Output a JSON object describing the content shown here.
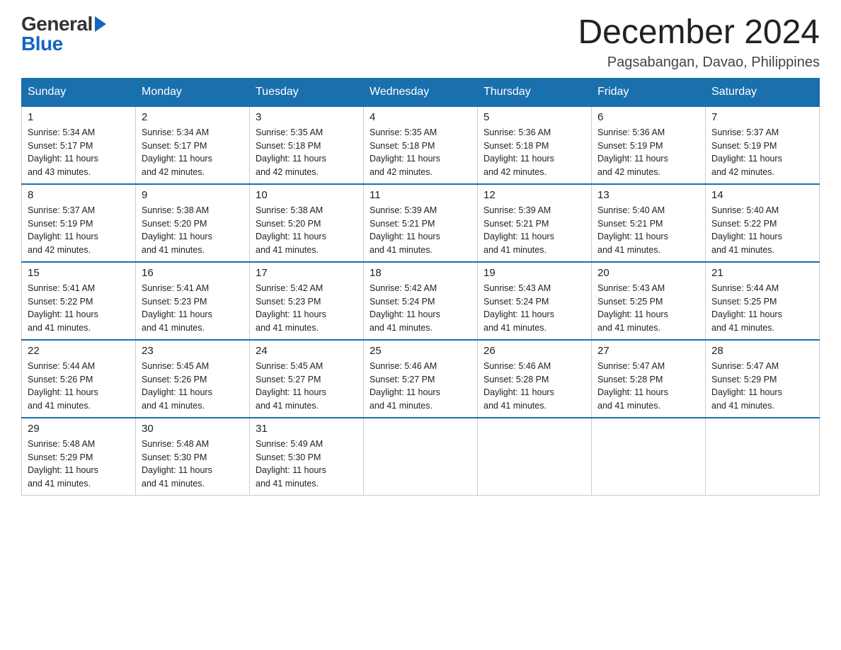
{
  "header": {
    "logo": {
      "line1": "General",
      "line2": "Blue"
    },
    "title": "December 2024",
    "location": "Pagsabangan, Davao, Philippines"
  },
  "days_of_week": [
    "Sunday",
    "Monday",
    "Tuesday",
    "Wednesday",
    "Thursday",
    "Friday",
    "Saturday"
  ],
  "weeks": [
    [
      {
        "day": "1",
        "sunrise": "5:34 AM",
        "sunset": "5:17 PM",
        "daylight": "11 hours and 43 minutes."
      },
      {
        "day": "2",
        "sunrise": "5:34 AM",
        "sunset": "5:17 PM",
        "daylight": "11 hours and 42 minutes."
      },
      {
        "day": "3",
        "sunrise": "5:35 AM",
        "sunset": "5:18 PM",
        "daylight": "11 hours and 42 minutes."
      },
      {
        "day": "4",
        "sunrise": "5:35 AM",
        "sunset": "5:18 PM",
        "daylight": "11 hours and 42 minutes."
      },
      {
        "day": "5",
        "sunrise": "5:36 AM",
        "sunset": "5:18 PM",
        "daylight": "11 hours and 42 minutes."
      },
      {
        "day": "6",
        "sunrise": "5:36 AM",
        "sunset": "5:19 PM",
        "daylight": "11 hours and 42 minutes."
      },
      {
        "day": "7",
        "sunrise": "5:37 AM",
        "sunset": "5:19 PM",
        "daylight": "11 hours and 42 minutes."
      }
    ],
    [
      {
        "day": "8",
        "sunrise": "5:37 AM",
        "sunset": "5:19 PM",
        "daylight": "11 hours and 42 minutes."
      },
      {
        "day": "9",
        "sunrise": "5:38 AM",
        "sunset": "5:20 PM",
        "daylight": "11 hours and 41 minutes."
      },
      {
        "day": "10",
        "sunrise": "5:38 AM",
        "sunset": "5:20 PM",
        "daylight": "11 hours and 41 minutes."
      },
      {
        "day": "11",
        "sunrise": "5:39 AM",
        "sunset": "5:21 PM",
        "daylight": "11 hours and 41 minutes."
      },
      {
        "day": "12",
        "sunrise": "5:39 AM",
        "sunset": "5:21 PM",
        "daylight": "11 hours and 41 minutes."
      },
      {
        "day": "13",
        "sunrise": "5:40 AM",
        "sunset": "5:21 PM",
        "daylight": "11 hours and 41 minutes."
      },
      {
        "day": "14",
        "sunrise": "5:40 AM",
        "sunset": "5:22 PM",
        "daylight": "11 hours and 41 minutes."
      }
    ],
    [
      {
        "day": "15",
        "sunrise": "5:41 AM",
        "sunset": "5:22 PM",
        "daylight": "11 hours and 41 minutes."
      },
      {
        "day": "16",
        "sunrise": "5:41 AM",
        "sunset": "5:23 PM",
        "daylight": "11 hours and 41 minutes."
      },
      {
        "day": "17",
        "sunrise": "5:42 AM",
        "sunset": "5:23 PM",
        "daylight": "11 hours and 41 minutes."
      },
      {
        "day": "18",
        "sunrise": "5:42 AM",
        "sunset": "5:24 PM",
        "daylight": "11 hours and 41 minutes."
      },
      {
        "day": "19",
        "sunrise": "5:43 AM",
        "sunset": "5:24 PM",
        "daylight": "11 hours and 41 minutes."
      },
      {
        "day": "20",
        "sunrise": "5:43 AM",
        "sunset": "5:25 PM",
        "daylight": "11 hours and 41 minutes."
      },
      {
        "day": "21",
        "sunrise": "5:44 AM",
        "sunset": "5:25 PM",
        "daylight": "11 hours and 41 minutes."
      }
    ],
    [
      {
        "day": "22",
        "sunrise": "5:44 AM",
        "sunset": "5:26 PM",
        "daylight": "11 hours and 41 minutes."
      },
      {
        "day": "23",
        "sunrise": "5:45 AM",
        "sunset": "5:26 PM",
        "daylight": "11 hours and 41 minutes."
      },
      {
        "day": "24",
        "sunrise": "5:45 AM",
        "sunset": "5:27 PM",
        "daylight": "11 hours and 41 minutes."
      },
      {
        "day": "25",
        "sunrise": "5:46 AM",
        "sunset": "5:27 PM",
        "daylight": "11 hours and 41 minutes."
      },
      {
        "day": "26",
        "sunrise": "5:46 AM",
        "sunset": "5:28 PM",
        "daylight": "11 hours and 41 minutes."
      },
      {
        "day": "27",
        "sunrise": "5:47 AM",
        "sunset": "5:28 PM",
        "daylight": "11 hours and 41 minutes."
      },
      {
        "day": "28",
        "sunrise": "5:47 AM",
        "sunset": "5:29 PM",
        "daylight": "11 hours and 41 minutes."
      }
    ],
    [
      {
        "day": "29",
        "sunrise": "5:48 AM",
        "sunset": "5:29 PM",
        "daylight": "11 hours and 41 minutes."
      },
      {
        "day": "30",
        "sunrise": "5:48 AM",
        "sunset": "5:30 PM",
        "daylight": "11 hours and 41 minutes."
      },
      {
        "day": "31",
        "sunrise": "5:49 AM",
        "sunset": "5:30 PM",
        "daylight": "11 hours and 41 minutes."
      },
      null,
      null,
      null,
      null
    ]
  ],
  "labels": {
    "sunrise": "Sunrise:",
    "sunset": "Sunset:",
    "daylight": "Daylight:"
  }
}
